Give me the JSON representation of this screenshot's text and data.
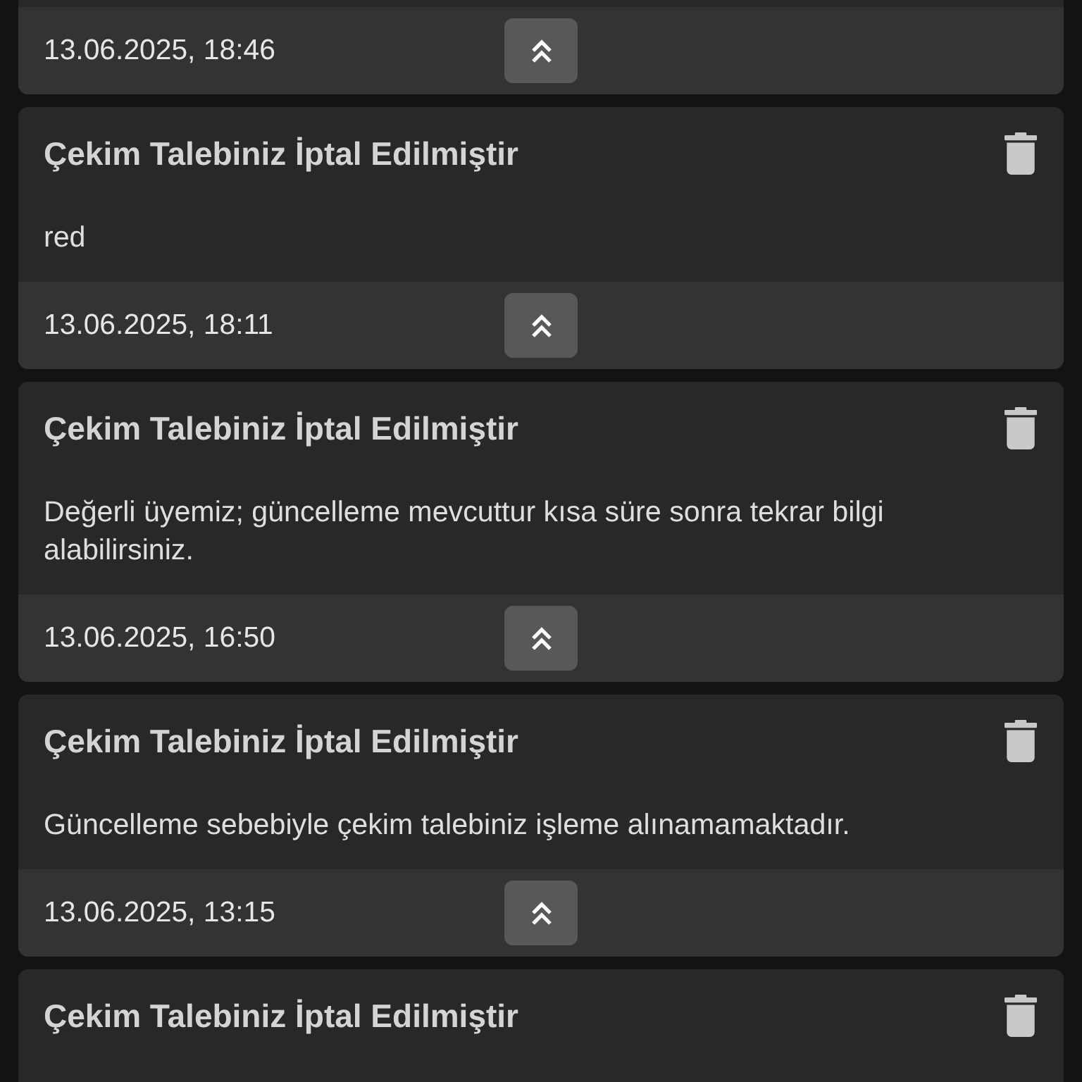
{
  "notifications": [
    {
      "date": "13.06.2025, 18:46"
    },
    {
      "title": "Çekim Talebiniz İptal Edilmiştir",
      "message": "red",
      "date": "13.06.2025, 18:11"
    },
    {
      "title": "Çekim Talebiniz İptal Edilmiştir",
      "message": "Değerli üyemiz; güncelleme mevcuttur kısa süre sonra tekrar bilgi alabilirsiniz.",
      "date": "13.06.2025, 16:50"
    },
    {
      "title": "Çekim Talebiniz İptal Edilmiştir",
      "message": "Güncelleme sebebiyle çekim talebiniz işleme alınamamaktadır.",
      "date": "13.06.2025, 13:15"
    },
    {
      "title": "Çekim Talebiniz İptal Edilmiştir"
    }
  ]
}
